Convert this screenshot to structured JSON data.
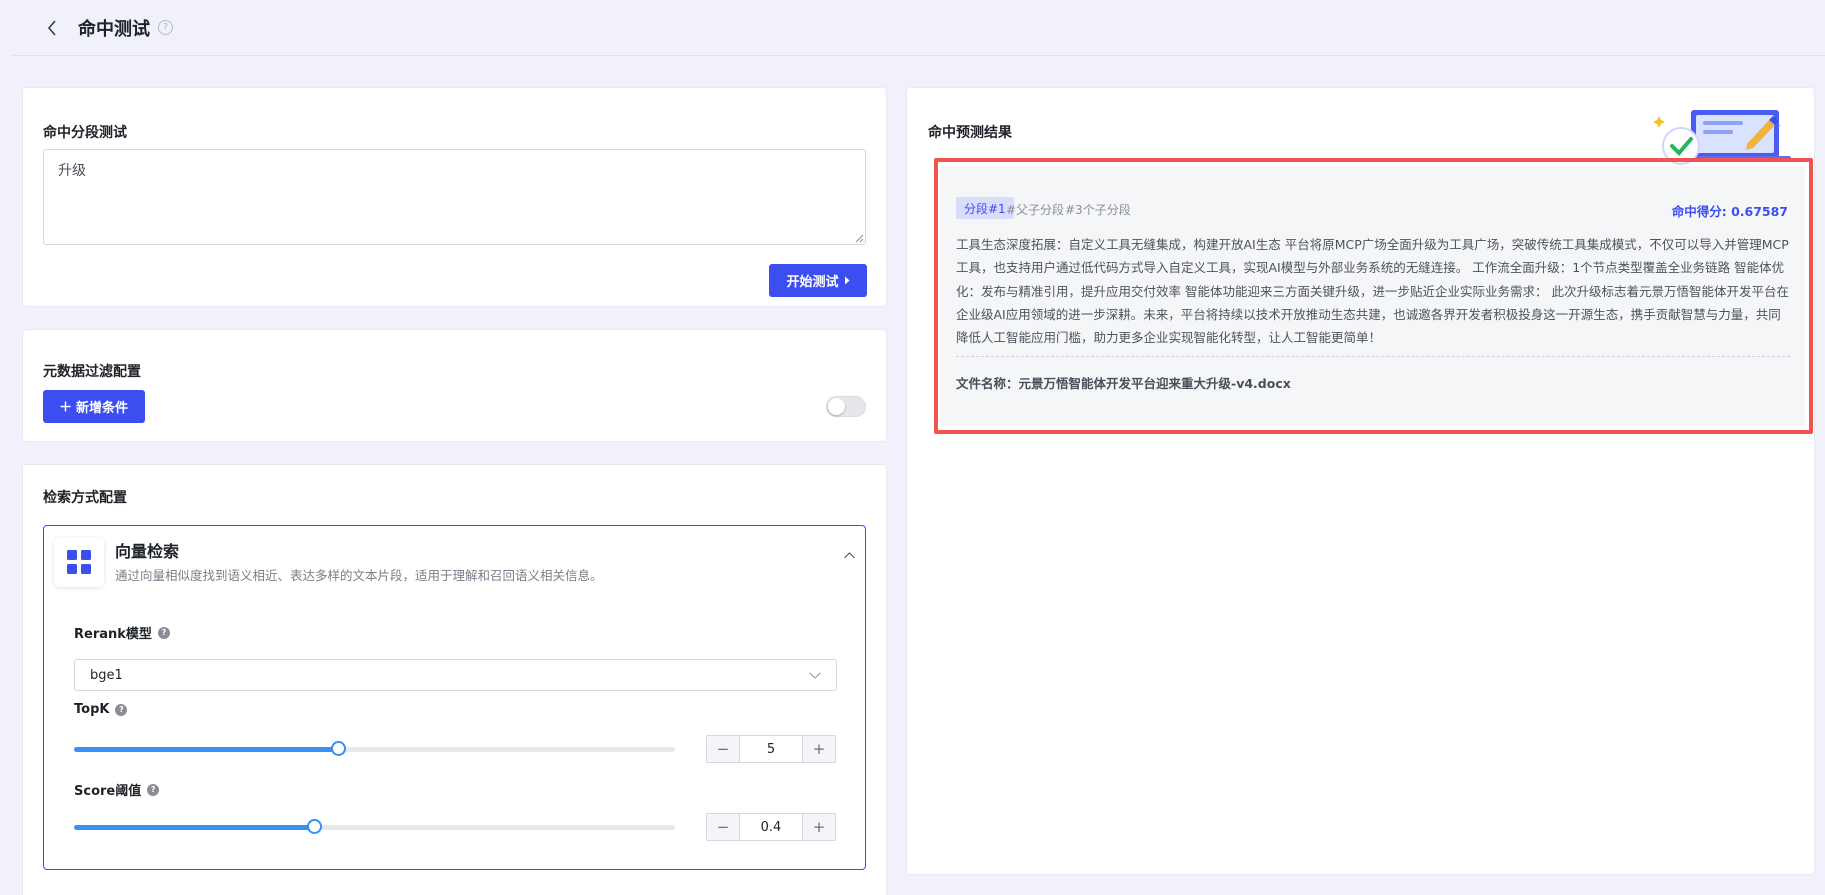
{
  "header": {
    "title": "命中测试"
  },
  "test_card": {
    "title": "命中分段测试",
    "query_value": "升级",
    "start_button_label": "开始测试"
  },
  "filter_card": {
    "title": "元数据过滤配置",
    "add_button_label": "新增条件",
    "toggle_enabled": false
  },
  "retrieval_card": {
    "title": "检索方式配置",
    "method": {
      "name": "向量检索",
      "description": "通过向量相似度找到语义相近、表达多样的文本片段，适用于理解和召回语义相关信息。"
    },
    "rerank_label": "Rerank模型",
    "rerank_value": "bge1",
    "topk_label": "TopK",
    "topk_value": "5",
    "topk_slider_fraction": 0.44,
    "score_label": "Score阈值",
    "score_value": "0.4",
    "score_slider_fraction": 0.4
  },
  "result_card": {
    "title": "命中预测结果",
    "results": [
      {
        "segment_tag": "分段#1",
        "meta_1": "#父子分段",
        "meta_2": "#3个子分段",
        "score_label": "命中得分: ",
        "score_value": "0.67587",
        "content": "工具生态深度拓展：自定义工具无缝集成，构建开放AI生态 平台将原MCP广场全面升级为工具广场，突破传统工具集成模式，不仅可以导入并管理MCP工具，也支持用户通过低代码方式导入自定义工具，实现AI模型与外部业务系统的无缝连接。 工作流全面升级：1个节点类型覆盖全业务链路 智能体优化：发布与精准引用，提升应用交付效率 智能体功能迎来三方面关键升级，进一步贴近企业实际业务需求： 此次升级标志着元景万悟智能体开发平台在企业级AI应用领域的进一步深耕。未来，平台将持续以技术开放推动生态共建，也诚邀各界开发者积极投身这一开源生态，携手贡献智慧与力量，共同降低人工智能应用门槛，助力更多企业实现智能化转型，让人工智能更简单！",
        "file_label": "文件名称：",
        "file_name": "元景万悟智能体开发平台迎来重大升级-v4.docx"
      }
    ]
  },
  "colors": {
    "primary": "#3d4ef0",
    "slider": "#3b8ff0",
    "highlight_frame": "#ef5352",
    "page_bg": "#f0f1fb"
  },
  "icons": [
    "chevron-left-icon",
    "help-circle-icon",
    "caret-right-icon",
    "plus-icon",
    "grid-icon",
    "chevron-up-icon",
    "chevron-down-icon",
    "question-icon",
    "minus-icon",
    "result-illustration"
  ]
}
